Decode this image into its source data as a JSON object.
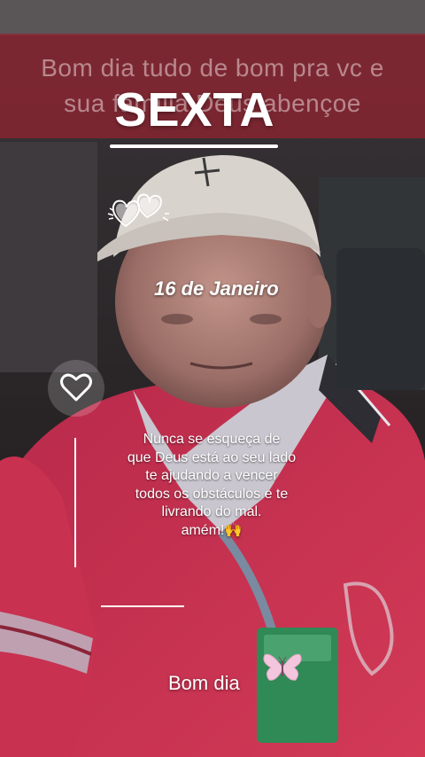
{
  "banner": {
    "line1": "Bom dia tudo de bom pra vc e",
    "line2": "sua família Deus abençoe"
  },
  "day": "SEXTA",
  "date": "16 de Janeiro",
  "message": {
    "line1": "Nunca se esqueça de",
    "line2": "que Deus está ao seu lado",
    "line3": "te ajudando a vencer",
    "line4": "todos os obstáculos e te",
    "line5": "livrando do mal.",
    "line6": "amém!🙌"
  },
  "greeting": "Bom dia",
  "colors": {
    "banner": "#962330",
    "shirt": "#c8314f",
    "cap": "#d9d3cd"
  },
  "icons": [
    "hearts-doodle-icon",
    "heart-like-icon",
    "butterfly-icon"
  ]
}
